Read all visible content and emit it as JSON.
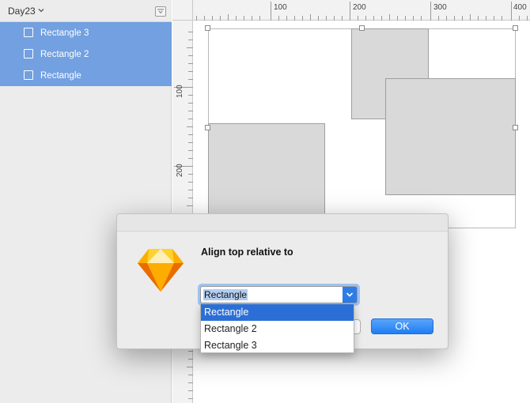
{
  "sidebar": {
    "page_name": "Day23",
    "layers": [
      {
        "label": "Rectangle 3"
      },
      {
        "label": "Rectangle 2"
      },
      {
        "label": "Rectangle"
      }
    ]
  },
  "rulers": {
    "top_labels": [
      "100",
      "200",
      "300",
      "400"
    ],
    "left_labels": [
      "100",
      "200"
    ]
  },
  "dialog": {
    "title": "Align top relative to",
    "select_value": "Rectangle",
    "options": [
      "Rectangle",
      "Rectangle 2",
      "Rectangle 3"
    ],
    "selected_index": 0,
    "ok_label": "OK"
  },
  "colors": {
    "selection_blue": "#72a0e0",
    "accent_blue": "#2b6fd6",
    "shape_fill": "#d9d9d9"
  },
  "icons": {
    "app_icon": "sketch-diamond-icon",
    "page_chevron": "chevron-down-icon",
    "layer_icon": "rectangle-layer-icon",
    "collapse": "collapse-panel-icon",
    "select_arrow": "chevron-down-icon"
  }
}
